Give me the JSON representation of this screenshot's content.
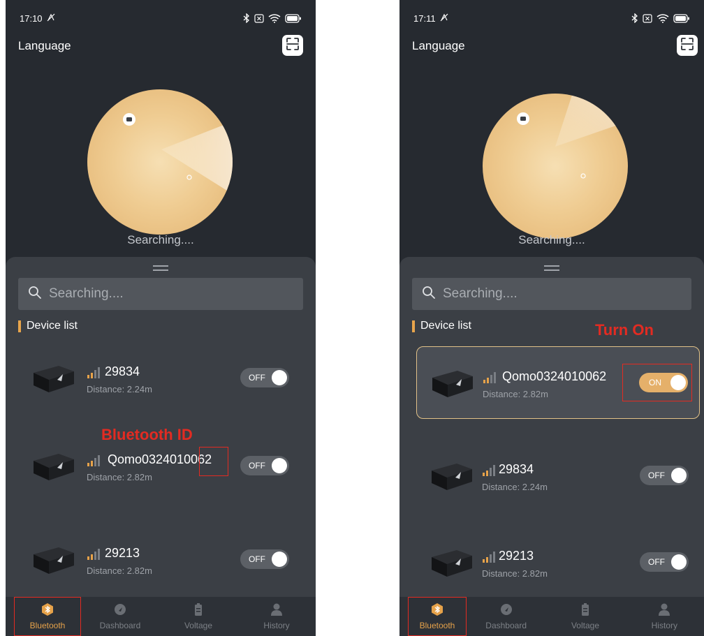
{
  "left": {
    "status": {
      "time": "17:10"
    },
    "header": {
      "language_label": "Language"
    },
    "radar": {
      "status_text": "Searching...."
    },
    "search": {
      "placeholder": "Searching...."
    },
    "device_list_title": "Device list",
    "devices": [
      {
        "name": "29834",
        "distance": "Distance: 2.24m",
        "toggle": "OFF"
      },
      {
        "name": "Qomo0324010062",
        "distance": "Distance: 2.82m",
        "toggle": "OFF"
      },
      {
        "name": "29213",
        "distance": "Distance: 2.82m",
        "toggle": "OFF"
      }
    ],
    "annotation": "Bluetooth ID",
    "tabs": [
      {
        "label": "Bluetooth"
      },
      {
        "label": "Dashboard"
      },
      {
        "label": "Voltage"
      },
      {
        "label": "History"
      }
    ]
  },
  "right": {
    "status": {
      "time": "17:11"
    },
    "header": {
      "language_label": "Language"
    },
    "radar": {
      "status_text": "Searching...."
    },
    "search": {
      "placeholder": "Searching...."
    },
    "device_list_title": "Device list",
    "devices": [
      {
        "name": "Qomo0324010062",
        "distance": "Distance: 2.82m",
        "toggle": "ON"
      },
      {
        "name": "29834",
        "distance": "Distance: 2.24m",
        "toggle": "OFF"
      },
      {
        "name": "29213",
        "distance": "Distance: 2.82m",
        "toggle": "OFF"
      }
    ],
    "annotation": "Turn On",
    "tabs": [
      {
        "label": "Bluetooth"
      },
      {
        "label": "Dashboard"
      },
      {
        "label": "Voltage"
      },
      {
        "label": "History"
      }
    ]
  },
  "colors": {
    "background": "#262a30",
    "sheet": "#3b3f45",
    "accent": "#e6a24a",
    "annotation_red": "#e32b22",
    "toggle_on": "#e5b06a"
  },
  "icons": [
    "bluetooth-icon",
    "wifi-icon",
    "battery-icon",
    "scan-icon",
    "search-icon",
    "signal-icon",
    "dashboard-icon",
    "voltage-icon",
    "history-icon"
  ]
}
